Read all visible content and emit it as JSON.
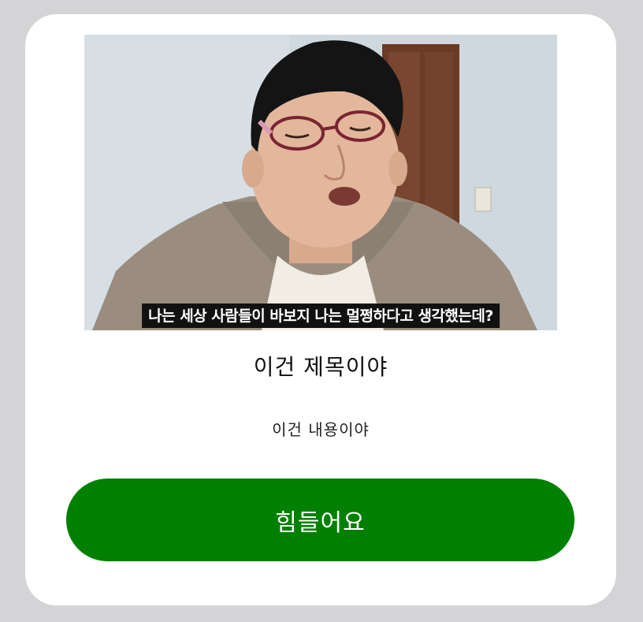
{
  "card": {
    "video_frame": {
      "subtitle_caption": "나는 세상 사람들이 바보지 나는 멀쩡하다고 생각했는데?"
    },
    "title": "이건 제목이야",
    "content": "이건 내용이야",
    "action_button_label": "힘들어요"
  },
  "colors": {
    "page_background": "#d4d4d6",
    "card_background": "#ffffff",
    "button_background": "#008000",
    "button_text": "#ffffff"
  }
}
